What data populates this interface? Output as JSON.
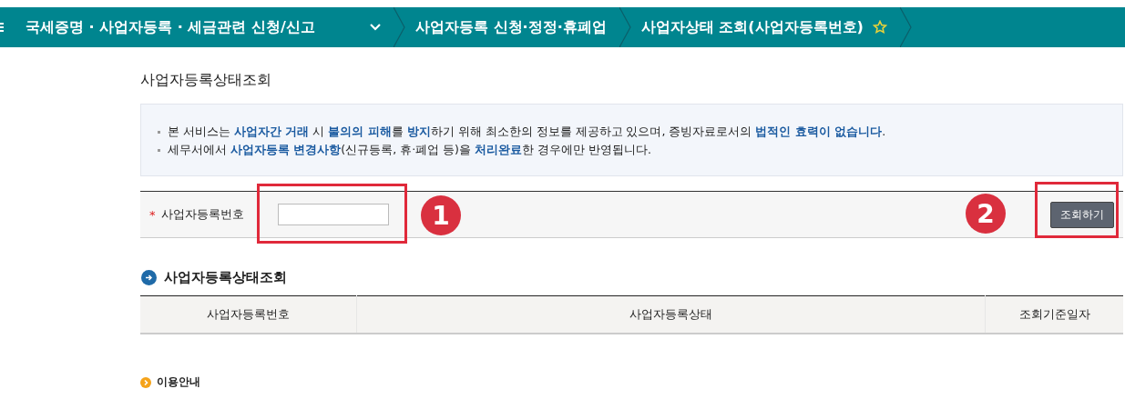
{
  "breadcrumb": [
    {
      "label": "국세증명 · 사업자등록 · 세금관련 신청/신고",
      "kind": "menu"
    },
    {
      "label": "사업자등록 신청·정정·휴폐업",
      "kind": "plain"
    },
    {
      "label": "사업자상태 조회(사업자등록번호)",
      "kind": "favorite"
    }
  ],
  "page_title": "사업자등록상태조회",
  "notices": [
    "본 서비스는 **사업자간 거래** 시 **불의의 피해**를 **방지**하기 위해 최소한의 정보를 제공하고 있으며, 증빙자료로서의 **법적인 효력이 없습니다**.",
    "세무서에서 **사업자등록 변경사항**(신규등록, 휴·폐업 등)을 **처리완료**한 경우에만 반영됩니다."
  ],
  "search": {
    "required_mark": "*",
    "label": "사업자등록번호",
    "button": "조회하기"
  },
  "annotations": [
    {
      "label": "1"
    },
    {
      "label": "2"
    }
  ],
  "results": {
    "title": "사업자등록상태조회",
    "columns": [
      "사업자등록번호",
      "사업자등록상태",
      "조회기준일자"
    ]
  },
  "guide": {
    "title": "이용안내"
  }
}
